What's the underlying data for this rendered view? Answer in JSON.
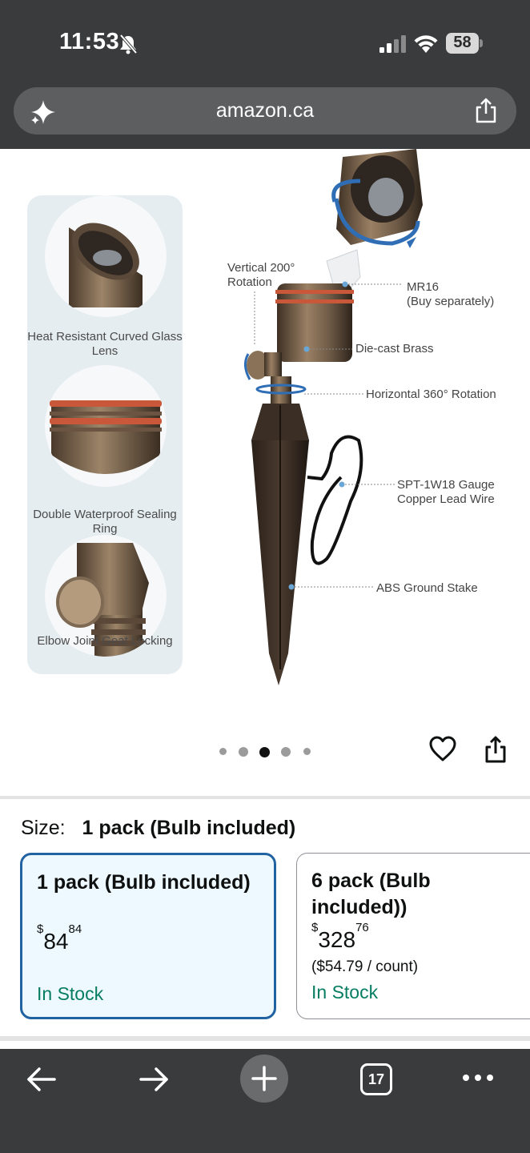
{
  "status_bar": {
    "time": "11:53",
    "battery": "58"
  },
  "browser": {
    "url": "amazon.ca",
    "tab_count": "17"
  },
  "product_image": {
    "features": [
      {
        "label": "Heat Resistant Curved Glass Lens"
      },
      {
        "label": "Double Waterproof Sealing Ring"
      },
      {
        "label": "Elbow Joint Geat Locking"
      }
    ],
    "callouts": {
      "vertical_1": "Vertical 200°",
      "vertical_2": "Rotation",
      "mr16_1": "MR16",
      "mr16_2": "(Buy separately)",
      "brass": "Die-cast Brass",
      "horizontal": "Horizontal 360° Rotation",
      "wire_1": "SPT-1W18 Gauge",
      "wire_2": "Copper Lead Wire",
      "stake": "ABS Ground Stake"
    },
    "carousel": {
      "total": 5,
      "active_index": 2
    }
  },
  "size_selector": {
    "label": "Size:",
    "selected": "1 pack (Bulb included)",
    "options": [
      {
        "title": "1 pack (Bulb included)",
        "currency": "$",
        "price_whole": "84",
        "price_fraction": "84",
        "stock": "In Stock"
      },
      {
        "title_line1": "6 pack (Bulb",
        "title_line2": "included))",
        "currency": "$",
        "price_whole": "328",
        "price_fraction": "76",
        "unit_price": "($54.79 / count)",
        "stock": "In Stock"
      }
    ]
  },
  "colors": {
    "chrome_bg": "#3a3b3c",
    "selected_border": "#2162a1",
    "selected_bg": "#edf8ff",
    "stock_green": "#067d62",
    "features_panel_bg": "#e5edf1"
  }
}
